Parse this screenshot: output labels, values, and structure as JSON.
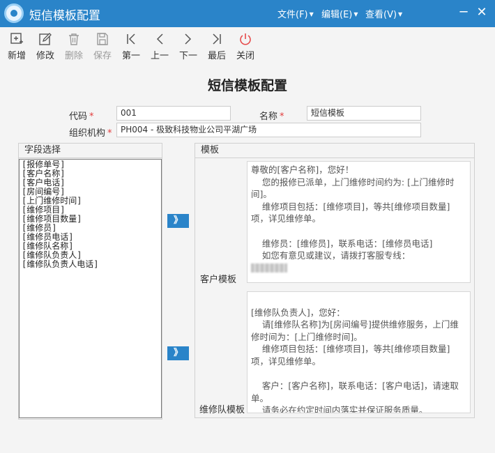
{
  "window": {
    "title": "短信模板配置",
    "menus": [
      "文件(F)",
      "编辑(E)",
      "查看(V)"
    ],
    "minimize_glyph": "─",
    "close_glyph": "✕"
  },
  "toolbar": {
    "add": "新增",
    "edit": "修改",
    "delete": "删除",
    "save": "保存",
    "first": "第一",
    "prev": "上一",
    "next": "下一",
    "last": "最后",
    "close": "关闭"
  },
  "form": {
    "title": "短信模板配置",
    "code_label": "代码",
    "code_value": "001",
    "name_label": "名称",
    "name_value": "短信模板",
    "org_label": "组织机构",
    "org_value": "PH004 - 极致科技物业公司平湖广场",
    "required_mark": "*"
  },
  "field_panel": {
    "header": "字段选择",
    "items": [
      "[报修单号]",
      "[客户名称]",
      "[客户电话]",
      "[房间编号]",
      "[上门维修时间]",
      "[维修项目]",
      "[维修项目数量]",
      "[维修员]",
      "[维修员电话]",
      "[维修队名称]",
      "[维修队负责人]",
      "[维修队负责人电话]"
    ],
    "insert_glyph": "》"
  },
  "template_panel": {
    "header": "模板",
    "customer": {
      "label": "客户模板",
      "lines": [
        "尊敬的[客户名称]，您好！",
        "    您的报修已派单，上门维修时间约为: [上门维修时间]。",
        "    维修项目包括：[维修项目]，等共[维修项目数量]项，详见维修单。",
        "",
        "    维修员：[维修员]，联系电话：[维修员电话]",
        "    如您有意见或建议，请拨打客服专线："
      ]
    },
    "team": {
      "label": "维修队模板",
      "lines": [
        "",
        "[维修队负责人]，您好：",
        "    请[维修队名称]为[房间编号]提供维修服务，上门维修时间为：[上门维修时间]。",
        "    维修项目包括：[维修项目]，等共[维修项目数量]项，详见维修单。",
        "",
        "    客户：[客户名称]，联系电话：[客户电话]，请速取单。",
        "    请务必在约定时间内落实并保证服务质量。"
      ]
    }
  },
  "colors": {
    "titlebar": "#2a84c9",
    "accent_button": "#2a84c9",
    "required": "#e23b3b",
    "close_icon": "#e64a4a"
  }
}
